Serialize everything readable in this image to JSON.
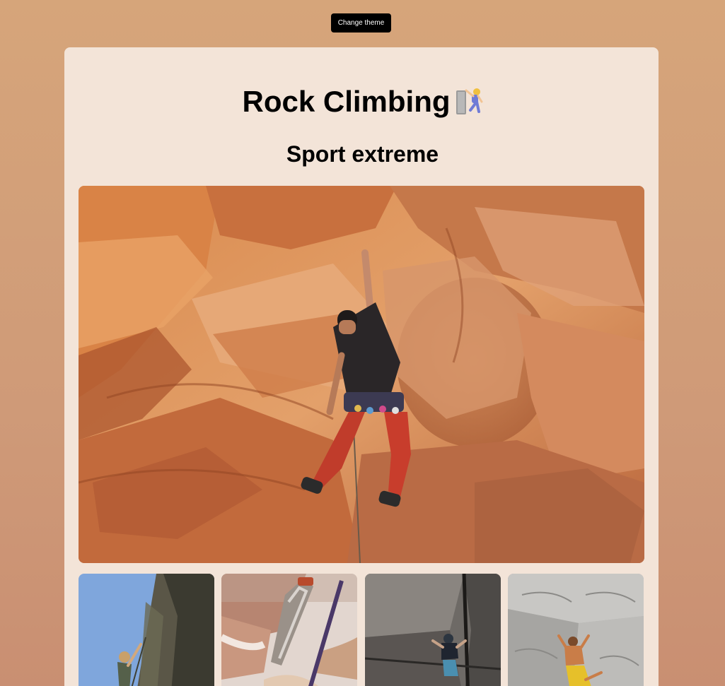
{
  "toolbar": {
    "change_theme_label": "Change theme"
  },
  "header": {
    "title": "Rock Climbing",
    "title_emoji_icon": "person-climbing-icon",
    "subtitle": "Sport extreme"
  },
  "theme": {
    "page_background": "#d6a57a",
    "card_background": "#f3e4d8",
    "button_background": "#000000",
    "text_color": "#000000"
  },
  "gallery": {
    "images": [
      {
        "name": "climber on red sandstone wall"
      },
      {
        "name": "climber on cliff against blue sky"
      },
      {
        "name": "hands with carabiner and rope"
      },
      {
        "name": "climber in dark rock crack"
      },
      {
        "name": "climber on grey limestone"
      }
    ]
  }
}
